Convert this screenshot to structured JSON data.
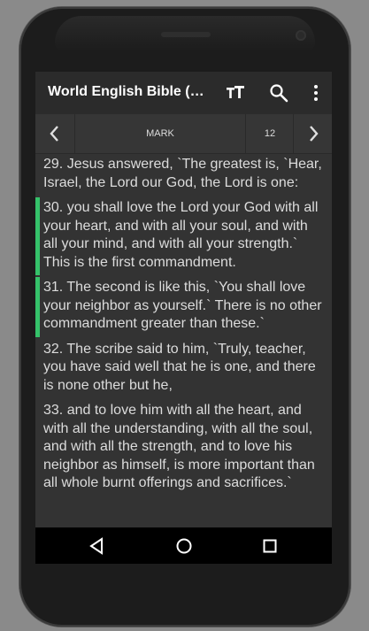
{
  "appbar": {
    "title": "World English Bible (…",
    "icons": [
      "text-size-icon",
      "search-icon",
      "more-vert-icon"
    ]
  },
  "nav": {
    "prev_icon": "chevron-left-icon",
    "book": "MARK",
    "chapter": "12",
    "next_icon": "chevron-right-icon"
  },
  "colors": {
    "highlight": "#35c26a",
    "background": "#333333",
    "appbar": "#2b2b2b",
    "text": "#dcdcdc"
  },
  "verses": [
    {
      "text": "29. Jesus answered, `The greatest is, `Hear, Israel, the Lord our God, the Lord is one:",
      "highlighted": false
    },
    {
      "text": "30. you shall love the Lord your God with all your heart, and with all your soul, and with all your mind, and with all your strength.` This is the first commandment.",
      "highlighted": true
    },
    {
      "text": "31. The second is like this, `You shall love your neighbor as yourself.` There is no other commandment greater than these.`",
      "highlighted": true
    },
    {
      "text": "32. The scribe said to him, `Truly, teacher, you have said well that he is one, and there is none other but he,",
      "highlighted": false
    },
    {
      "text": "33. and to love him with all the heart, and with all the understanding, with all the soul, and with all the strength, and to love his neighbor as himself, is more important than all whole burnt offerings and sacrifices.`",
      "highlighted": false
    }
  ],
  "system_nav": [
    "back-icon",
    "home-icon",
    "recents-icon"
  ]
}
